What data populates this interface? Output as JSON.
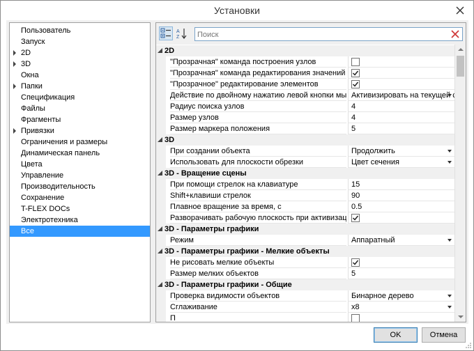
{
  "window": {
    "title": "Установки"
  },
  "tree": {
    "items": [
      {
        "label": "Пользователь",
        "expandable": false,
        "selected": false
      },
      {
        "label": "Запуск",
        "expandable": false,
        "selected": false
      },
      {
        "label": "2D",
        "expandable": true,
        "selected": false
      },
      {
        "label": "3D",
        "expandable": true,
        "selected": false
      },
      {
        "label": "Окна",
        "expandable": false,
        "selected": false
      },
      {
        "label": "Папки",
        "expandable": true,
        "selected": false
      },
      {
        "label": "Спецификация",
        "expandable": false,
        "selected": false
      },
      {
        "label": "Файлы",
        "expandable": false,
        "selected": false
      },
      {
        "label": "Фрагменты",
        "expandable": false,
        "selected": false
      },
      {
        "label": "Привязки",
        "expandable": true,
        "selected": false
      },
      {
        "label": "Ограничения и размеры",
        "expandable": false,
        "selected": false
      },
      {
        "label": "Динамическая панель",
        "expandable": false,
        "selected": false
      },
      {
        "label": "Цвета",
        "expandable": false,
        "selected": false
      },
      {
        "label": "Управление",
        "expandable": false,
        "selected": false
      },
      {
        "label": "Производительность",
        "expandable": false,
        "selected": false
      },
      {
        "label": "Сохранение",
        "expandable": false,
        "selected": false
      },
      {
        "label": "T-FLEX DOCs",
        "expandable": false,
        "selected": false
      },
      {
        "label": "Электротехника",
        "expandable": false,
        "selected": false
      },
      {
        "label": "Все",
        "expandable": false,
        "selected": true
      }
    ]
  },
  "search": {
    "placeholder": "Поиск",
    "value": ""
  },
  "grid": {
    "rows": [
      {
        "type": "category",
        "label": "2D"
      },
      {
        "type": "prop",
        "name": "\"Прозрачная\" команда построения узлов",
        "kind": "checkbox",
        "checked": false
      },
      {
        "type": "prop",
        "name": "\"Прозрачная\" команда редактирования значений р...",
        "kind": "checkbox",
        "checked": true
      },
      {
        "type": "prop",
        "name": "\"Прозрачное\" редактирование элементов",
        "kind": "checkbox",
        "checked": true
      },
      {
        "type": "prop",
        "name": "Действие по двойному нажатию левой кнопки мы...",
        "kind": "dropdown",
        "value": "Активизировать на текущей с"
      },
      {
        "type": "prop",
        "name": "Радиус поиска узлов",
        "kind": "text",
        "value": "4"
      },
      {
        "type": "prop",
        "name": "Размер узлов",
        "kind": "text",
        "value": "4"
      },
      {
        "type": "prop",
        "name": "Размер маркера положения",
        "kind": "text",
        "value": "5"
      },
      {
        "type": "category",
        "label": "3D"
      },
      {
        "type": "prop",
        "name": "При создании объекта",
        "kind": "dropdown",
        "value": "Продолжить"
      },
      {
        "type": "prop",
        "name": "Использовать для плоскости обрезки",
        "kind": "dropdown",
        "value": "Цвет сечения"
      },
      {
        "type": "category",
        "label": "3D - Вращение сцены"
      },
      {
        "type": "prop",
        "name": "При помощи стрелок на клавиатуре",
        "kind": "text",
        "value": "15"
      },
      {
        "type": "prop",
        "name": "Shift+клавиши стрелок",
        "kind": "text",
        "value": "90"
      },
      {
        "type": "prop",
        "name": "Плавное вращение за время, с",
        "kind": "text",
        "value": "0.5"
      },
      {
        "type": "prop",
        "name": "Разворачивать рабочую плоскость при активизации",
        "kind": "checkbox",
        "checked": true
      },
      {
        "type": "category",
        "label": "3D - Параметры графики"
      },
      {
        "type": "prop",
        "name": "Режим",
        "kind": "dropdown",
        "value": "Аппаратный"
      },
      {
        "type": "category",
        "label": "3D - Параметры графики - Мелкие объекты"
      },
      {
        "type": "prop",
        "name": "Не рисовать мелкие объекты",
        "kind": "checkbox",
        "checked": true
      },
      {
        "type": "prop",
        "name": "Размер мелких объектов",
        "kind": "text",
        "value": "5"
      },
      {
        "type": "category",
        "label": "3D - Параметры графики - Общие"
      },
      {
        "type": "prop",
        "name": "Проверка видимости объектов",
        "kind": "dropdown",
        "value": "Бинарное дерево"
      },
      {
        "type": "prop",
        "name": "Сглаживание",
        "kind": "dropdown",
        "value": "x8"
      },
      {
        "type": "prop",
        "name": "П",
        "kind": "checkbox",
        "checked": false
      }
    ]
  },
  "buttons": {
    "ok": "OK",
    "cancel": "Отмена"
  },
  "colors": {
    "selection": "#3399ff",
    "category_bg": "#f0f0f0",
    "close_hover": "#c42b1c"
  },
  "icons": {
    "close": "close-icon",
    "categorized": "categorized-view-icon",
    "sort": "sort-alphabetical-icon",
    "clear": "clear-search-icon"
  }
}
